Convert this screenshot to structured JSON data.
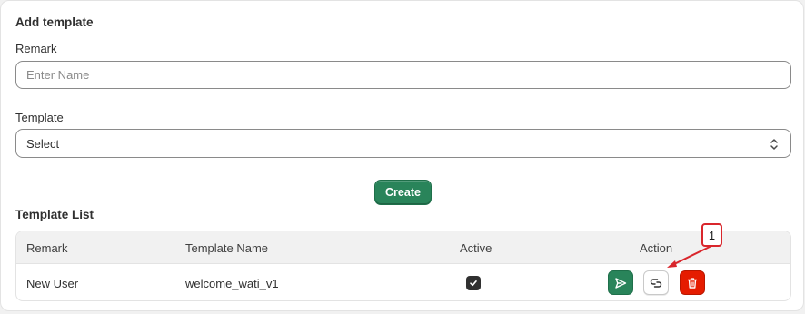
{
  "form": {
    "title": "Add template",
    "remark_label": "Remark",
    "remark_placeholder": "Enter Name",
    "template_label": "Template",
    "template_value": "Select",
    "create_label": "Create"
  },
  "list": {
    "title": "Template List",
    "columns": [
      "Remark",
      "Template Name",
      "Active",
      "Action"
    ],
    "rows": [
      {
        "remark": "New User",
        "template_name": "welcome_wati_v1",
        "active": true
      }
    ]
  },
  "annotation": {
    "marker_label": "1",
    "color": "#d9262c"
  },
  "colors": {
    "primary": "#29845a",
    "danger": "#e51c00"
  },
  "icons": {
    "send": "send-icon",
    "copy": "copy-icon",
    "delete": "trash-icon",
    "select": "chevron-up-down-icon",
    "check": "check-icon"
  }
}
